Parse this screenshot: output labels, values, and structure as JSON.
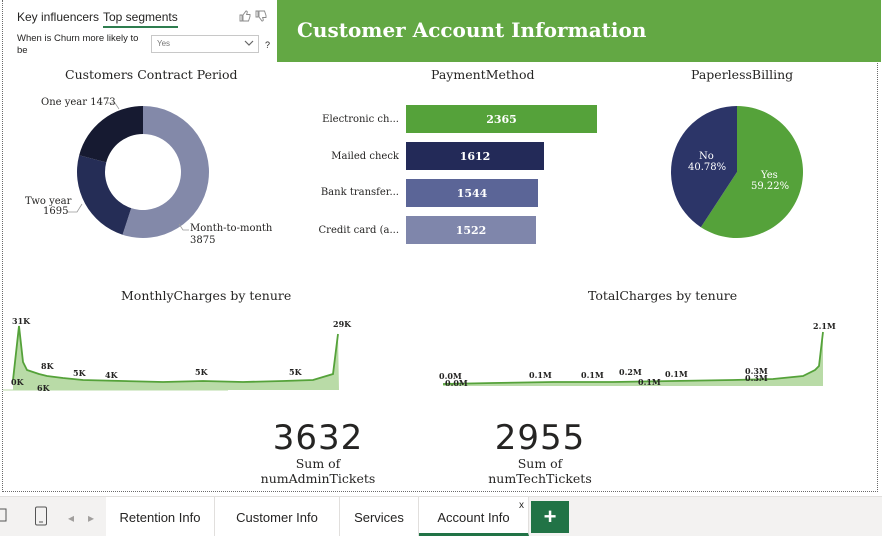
{
  "key_influencers": {
    "tab1": "Key influencers",
    "tab2": "Top segments",
    "question": "When is Churn more likely to be",
    "selected": "Yes",
    "help": "?"
  },
  "banner": {
    "title": "Customer Account Information",
    "color": "#63a844"
  },
  "contract": {
    "title": "Customers Contract Period",
    "labels": {
      "one_year": "One year 1473",
      "two_year_1": "Two year",
      "two_year_2": "1695",
      "m2m_1": "Month-to-month",
      "m2m_2": "3875"
    }
  },
  "payment": {
    "title": "PaymentMethod",
    "cats": [
      "Electronic ch...",
      "Mailed check",
      "Bank transfer...",
      "Credit card (a..."
    ],
    "vals": [
      "2365",
      "1612",
      "1544",
      "1522"
    ]
  },
  "paperless": {
    "title": "PaperlessBilling",
    "no_name": "No",
    "no_pct": "40.78%",
    "yes_name": "Yes",
    "yes_pct": "59.22%"
  },
  "monthly": {
    "title": "MonthlyCharges by tenure",
    "labels": [
      "31K",
      "0K",
      "8K",
      "6K",
      "5K",
      "4K",
      "5K",
      "5K",
      "29K"
    ]
  },
  "total": {
    "title": "TotalCharges by tenure",
    "labels": [
      "0.0M",
      "0.0M",
      "0.1M",
      "0.1M",
      "0.2M",
      "0.1M",
      "0.1M",
      "0.3M",
      "0.3M",
      "2.1M"
    ]
  },
  "kpi": {
    "admin_val": "3632",
    "admin_lbl": "Sum of numAdminTickets",
    "tech_val": "2955",
    "tech_lbl": "Sum of numTechTickets"
  },
  "tabs": {
    "t1": "Retention Info",
    "t2": "Customer Info",
    "t3": "Services",
    "t4": "Account Info",
    "close": "x",
    "add": "+"
  },
  "chart_data": [
    {
      "type": "pie",
      "title": "Customers Contract Period",
      "categories": [
        "Month-to-month",
        "Two year",
        "One year"
      ],
      "values": [
        3875,
        1695,
        1473
      ],
      "colors": [
        "#8389a9",
        "#252d56",
        "#161a31"
      ]
    },
    {
      "type": "bar",
      "title": "PaymentMethod",
      "categories": [
        "Electronic ch...",
        "Mailed check",
        "Bank transfer...",
        "Credit card (a..."
      ],
      "values": [
        2365,
        1612,
        1544,
        1522
      ],
      "colors": [
        "#55a23a",
        "#232a58",
        "#5b6597",
        "#7f86ab"
      ]
    },
    {
      "type": "pie",
      "title": "PaperlessBilling",
      "categories": [
        "Yes",
        "No"
      ],
      "values": [
        59.22,
        40.78
      ],
      "colors": [
        "#55a23a",
        "#2c3568"
      ]
    },
    {
      "type": "area",
      "title": "MonthlyCharges by tenure",
      "x": [
        1,
        2,
        3,
        4,
        5,
        10,
        20,
        30,
        40,
        50,
        60,
        70,
        71,
        72
      ],
      "y": [
        31,
        0,
        8,
        6,
        5,
        4,
        5,
        5,
        5,
        5,
        5,
        5,
        8,
        29
      ],
      "units": "K",
      "color": "#63a844"
    },
    {
      "type": "area",
      "title": "TotalCharges by tenure",
      "x": [
        1,
        2,
        10,
        20,
        30,
        40,
        50,
        60,
        70,
        71,
        72
      ],
      "y": [
        0.0,
        0.0,
        0.1,
        0.1,
        0.2,
        0.1,
        0.1,
        0.3,
        0.3,
        0.5,
        2.1
      ],
      "units": "M",
      "color": "#63a844"
    }
  ]
}
